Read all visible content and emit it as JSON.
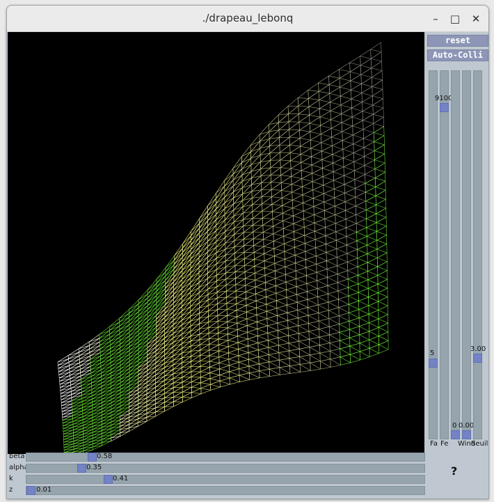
{
  "window": {
    "title": "./drapeau_lebonq"
  },
  "buttons": {
    "reset": "reset",
    "auto_colli": "Auto-Colli",
    "help": "?"
  },
  "vertical_sliders": [
    {
      "label": "Fa",
      "value": "5",
      "level": 0.2
    },
    {
      "label": "Fe",
      "value": "9100",
      "level": 0.91
    },
    {
      "label": "",
      "value": "0",
      "level": 0.0
    },
    {
      "label": "Wind",
      "value": "0.00",
      "level": 0.0
    },
    {
      "label": "Seuil",
      "value": "3.00",
      "level": 0.22
    }
  ],
  "horizontal_sliders": [
    {
      "label": "beta",
      "value": "0.58",
      "level": 0.17
    },
    {
      "label": "alpha",
      "value": "0.35",
      "level": 0.135
    },
    {
      "label": "k",
      "value": "0.41",
      "level": 0.205
    },
    {
      "label": "z",
      "value": "0.01",
      "level": 0.01
    }
  ],
  "colors": {
    "mesh_light": "#ffffff",
    "mesh_yellow": "#f2f27a",
    "mesh_green": "#66dd33",
    "mesh_gray": "#7f7f7f",
    "slider_thumb": "#7383c6",
    "slider_track": "#95a4ad"
  }
}
